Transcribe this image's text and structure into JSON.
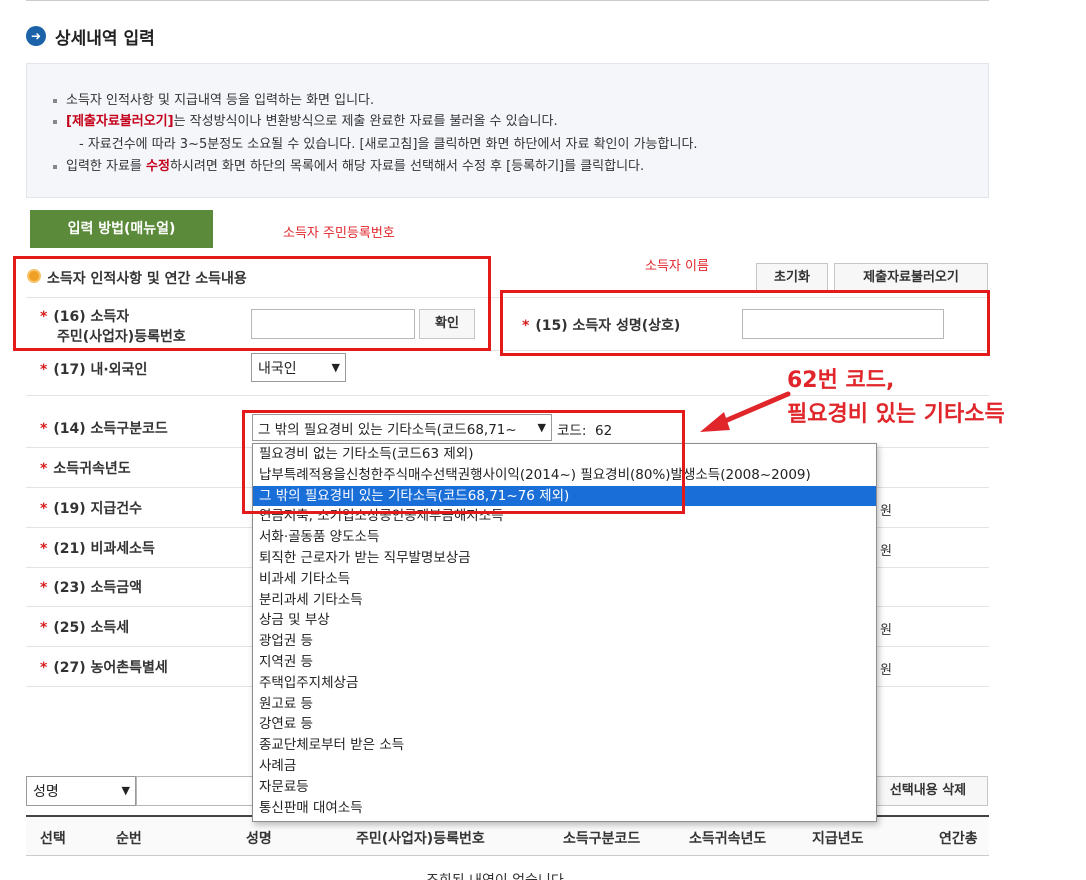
{
  "page": {
    "title": "상세내역 입력"
  },
  "info": {
    "line1": "소득자 인적사항 및 지급내역 등을 입력하는 화면 입니다.",
    "line2_highlight": "[제출자료불러오기]",
    "line2_rest": "는 작성방식이나 변환방식으로 제출 완료한 자료를 불러올 수 있습니다.",
    "line3": "- 자료건수에 따라 3~5분정도 소요될 수 있습니다. [새로고침]을 클릭하면 화면 하단에서 자료 확인이 가능합니다.",
    "line4_pre": "입력한 자료를 ",
    "line4_highlight": "수정",
    "line4_post": "하시려면 화면 하단의 목록에서 해당 자료를 선택해서 수정 후 [등록하기]를 클릭합니다."
  },
  "buttons": {
    "manual": "입력 방법(매뉴얼)",
    "reset": "초기화",
    "load": "제출자료불러오기",
    "confirm": "확인",
    "delete_selected": "선택내용 삭제"
  },
  "annotations": {
    "resident_no": "소득자 주민등록번호",
    "name": "소득자 이름",
    "code_line1": "62번 코드,",
    "code_line2": "필요경비 있는 기타소득"
  },
  "section": {
    "title": "소득자 인적사항 및 연간 소득내용"
  },
  "fields": {
    "star": "*",
    "resident_label_1": "(16) 소득자",
    "resident_label_2": "주민(사업자)등록번호",
    "name_label": "(15) 소득자 성명(상호)",
    "nationality_label": "(17) 내·외국인",
    "nationality_value": "내국인",
    "income_code_label": "(14) 소득구분코드",
    "income_code_value": "그 밖의 필요경비 있는 기타소득(코드68,71~",
    "code_text": "코드:",
    "code_number": "62",
    "income_year_label": "소득귀속년도",
    "pay_count_label": "(19) 지급건수",
    "nontax_label": "(21) 비과세소득",
    "income_amount_label": "(23) 소득금액",
    "income_tax_label": "(25) 소득세",
    "rural_tax_label": "(27) 농어촌특별세",
    "won": "원"
  },
  "dropdown": {
    "items": [
      "필요경비 없는 기타소득(코드63 제외)",
      "납부특례적용을신청한주식매수선택권행사이익(2014~) 필요경비(80%)발생소득(2008~2009)",
      "그 밖의 필요경비 있는 기타소득(코드68,71~76 제외)",
      "연금저축, 소기업소상공인공제부금해지소득",
      "서화·골동품 양도소득",
      "퇴직한 근로자가 받는 직무발명보상금",
      "비과세 기타소득",
      "분리과세 기타소득",
      "상금 및 부상",
      "광업권 등",
      "지역권 등",
      "주택입주지체상금",
      "원고료 등",
      "강연료 등",
      "종교단체로부터 받은 소득",
      "사례금",
      "자문료등",
      "통신판매 대여소득"
    ],
    "selected_index": 2
  },
  "search": {
    "select_value": "성명"
  },
  "table": {
    "headers": [
      "선택",
      "순번",
      "성명",
      "주민(사업자)등록번호",
      "소득구분코드",
      "소득귀속년도",
      "지급년도",
      "연간총"
    ],
    "empty_message": "조회된 내역이 없습니다"
  }
}
